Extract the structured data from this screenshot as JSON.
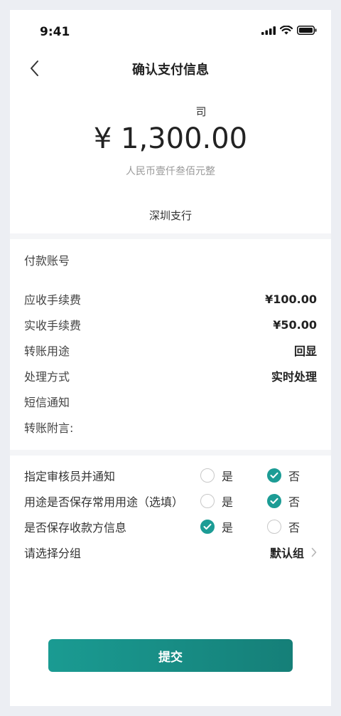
{
  "status_bar": {
    "time": "9:41"
  },
  "nav": {
    "title": "确认支付信息"
  },
  "payee": {
    "company_suffix": "司",
    "amount": "¥ 1,300.00",
    "amount_chinese": "人民币壹仟叁佰元整",
    "branch": "深圳支行"
  },
  "details": {
    "account_label": "付款账号",
    "rows": [
      {
        "label": "应收手续费",
        "value": "¥100.00"
      },
      {
        "label": "实收手续费",
        "value": "¥50.00"
      },
      {
        "label": "转账用途",
        "value": "回显"
      },
      {
        "label": "处理方式",
        "value": "实时处理"
      },
      {
        "label": "短信通知",
        "value": ""
      },
      {
        "label": "转账附言:",
        "value": ""
      }
    ]
  },
  "options": {
    "yes_label": "是",
    "no_label": "否",
    "items": [
      {
        "label": "指定审核员并通知",
        "selected": "否"
      },
      {
        "label": "用途是否保存常用用途（选填）",
        "selected": "否"
      },
      {
        "label": "是否保存收款方信息",
        "selected": "是"
      }
    ],
    "group": {
      "label": "请选择分组",
      "value": "默认组"
    }
  },
  "submit_label": "提交",
  "colors": {
    "accent": "#1c9c95",
    "button_start": "#1a9b92",
    "button_end": "#157f78"
  },
  "icons": [
    "signal-icon",
    "wifi-icon",
    "battery-icon",
    "back-arrow-icon",
    "check-icon",
    "chevron-right-icon"
  ]
}
